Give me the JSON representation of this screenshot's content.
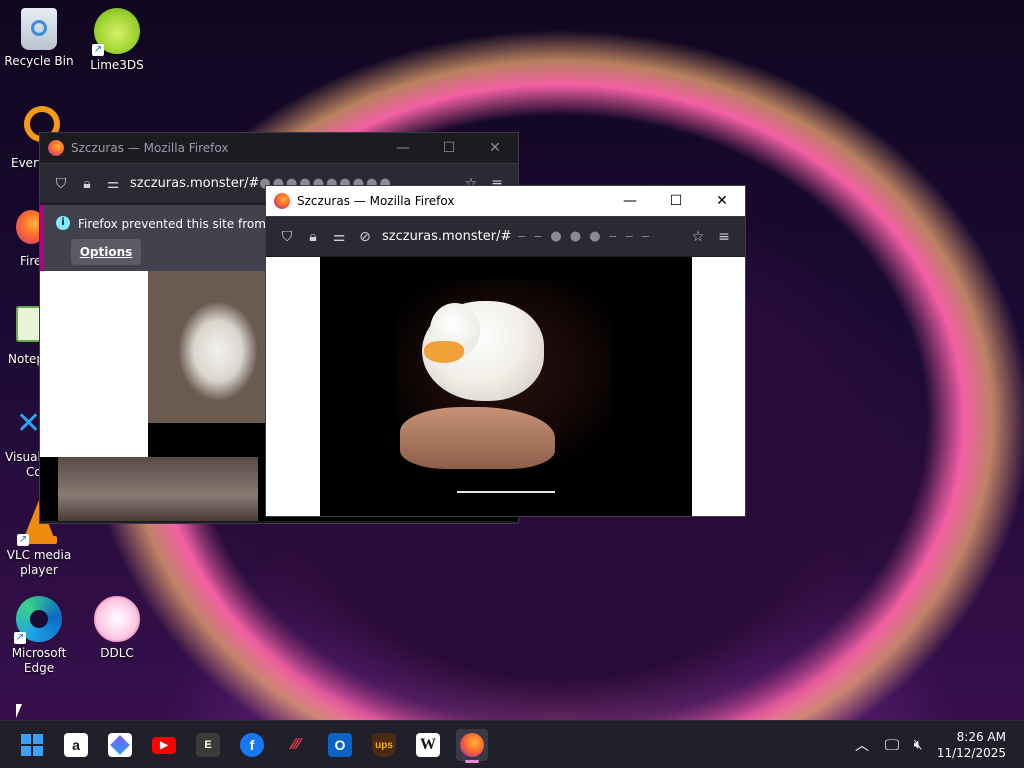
{
  "desktop": {
    "icons": [
      {
        "label": "Recycle Bin"
      },
      {
        "label": "Lime3DS"
      },
      {
        "label": "VLC media player"
      },
      {
        "label": "Microsoft Edge"
      },
      {
        "label": "DDLC"
      }
    ],
    "partial_labels": {
      "every": "Every",
      "fire": "Fire",
      "notep": "Notep",
      "visual": "Visual",
      "cod": "Cod"
    }
  },
  "window_back": {
    "title": "Szczuras — Mozilla Firefox",
    "url": "szczuras.monster/#",
    "notification": "Firefox prevented this site from ope",
    "options_label": "Options"
  },
  "window_front": {
    "title": "Szczuras — Mozilla Firefox",
    "url": "szczuras.monster/#"
  },
  "taskbar": {
    "apps": [
      "start",
      "amazon",
      "copilot",
      "youtube",
      "epic-games",
      "facebook",
      "bookmarks",
      "outlook",
      "ups",
      "wikipedia",
      "firefox"
    ],
    "time": "8:26 AM",
    "date": "11/12/2025"
  },
  "colors": {
    "firefox_toolbar": "#2b2a33",
    "notification_accent": "#b5007f",
    "taskbar_bg": "#20202a"
  }
}
